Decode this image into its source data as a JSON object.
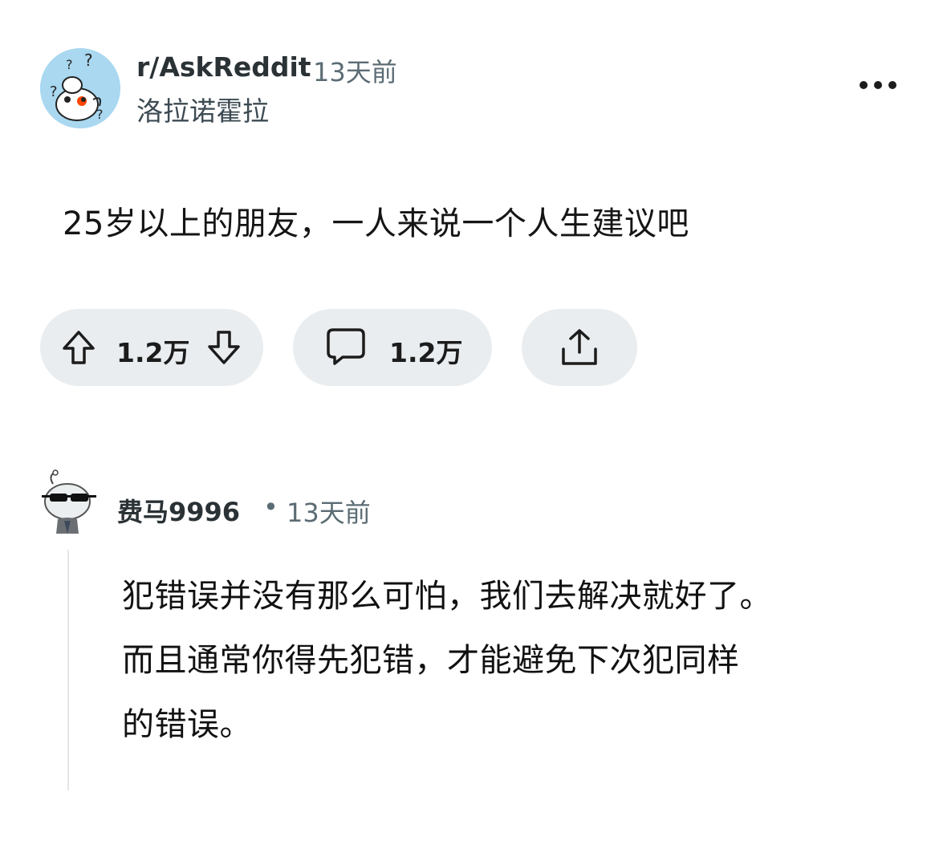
{
  "post": {
    "subreddit": "r/AskReddit",
    "time": "13天前",
    "author": "洛拉诺霍拉",
    "title": "25岁以上的朋友，一人来说一个人生建议吧",
    "more_icon": "more-horizontal-icon",
    "subreddit_avatar_icon": "reddit-snoo-question-icon"
  },
  "actions": {
    "votes": "1.2万",
    "comments": "1.2万",
    "upvote_icon": "arrow-up-icon",
    "downvote_icon": "arrow-down-icon",
    "comment_icon": "speech-bubble-icon",
    "share_icon": "share-icon",
    "pill_color": "#eaedef"
  },
  "comment": {
    "username": "费马9996",
    "separator": "•",
    "time": "13天前",
    "lines": [
      "犯错误并没有那么可怕，我们去解决就好了。",
      "而且通常你得先犯错，才能避免下次犯同样",
      "的错误。"
    ],
    "avatar_icon": "snoo-sunglasses-avatar"
  },
  "colors": {
    "background": "#ffffff",
    "text_primary": "#1c1c1c",
    "text_secondary": "#5c6c74",
    "avatar_bg": "#a9d8f0",
    "snoo_red": "#ff4500"
  }
}
